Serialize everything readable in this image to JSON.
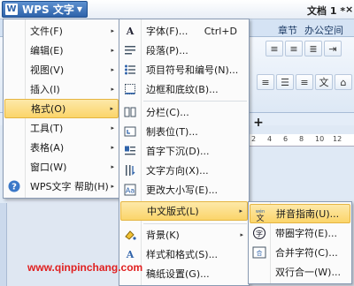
{
  "app": {
    "name": "WPS 文字",
    "logo": "W",
    "doc_title": "文档 1 *",
    "close": "×"
  },
  "ribbon": {
    "tabs": [
      "章节",
      "办公空间"
    ],
    "plus": "+",
    "ruler": [
      "2",
      "4",
      "6",
      "8",
      "10",
      "12"
    ]
  },
  "main_menu": {
    "items": [
      {
        "label": "文件(F)",
        "icon": "",
        "arrow": "▸"
      },
      {
        "label": "编辑(E)",
        "icon": "",
        "arrow": "▸"
      },
      {
        "label": "视图(V)",
        "icon": "",
        "arrow": "▸"
      },
      {
        "label": "插入(I)",
        "icon": "",
        "arrow": "▸"
      },
      {
        "label": "格式(O)",
        "icon": "",
        "arrow": "▸",
        "highlighted": true
      },
      {
        "label": "工具(T)",
        "icon": "",
        "arrow": "▸"
      },
      {
        "label": "表格(A)",
        "icon": "",
        "arrow": "▸"
      },
      {
        "label": "窗口(W)",
        "icon": "",
        "arrow": "▸"
      },
      {
        "label": "WPS文字 帮助(H)",
        "icon": "help-icon",
        "arrow": "▸"
      }
    ]
  },
  "format_menu": {
    "items": [
      {
        "label": "字体(F)...",
        "shortcut": "Ctrl+D",
        "icon": "font-icon"
      },
      {
        "label": "段落(P)...",
        "icon": "paragraph-icon"
      },
      {
        "label": "项目符号和编号(N)...",
        "icon": "bullets-icon"
      },
      {
        "label": "边框和底纹(B)...",
        "icon": "borders-icon"
      },
      {
        "label": "分栏(C)...",
        "icon": "columns-icon"
      },
      {
        "label": "制表位(T)...",
        "icon": "tabstop-icon"
      },
      {
        "label": "首字下沉(D)...",
        "icon": "dropcap-icon"
      },
      {
        "label": "文字方向(X)...",
        "icon": "text-direction-icon"
      },
      {
        "label": "更改大小写(E)...",
        "icon": "change-case-icon"
      },
      {
        "label": "中文版式(L)",
        "icon": "",
        "arrow": "▸",
        "highlighted": true
      },
      {
        "label": "背景(K)",
        "icon": "background-icon",
        "arrow": "▸"
      },
      {
        "label": "样式和格式(S)...",
        "icon": "styles-icon"
      },
      {
        "label": "稿纸设置(G)...",
        "icon": "manuscript-icon"
      }
    ]
  },
  "chinese_layout_menu": {
    "items": [
      {
        "label": "拼音指南(U)...",
        "icon": "pinyin-icon",
        "highlighted": true
      },
      {
        "label": "带圈字符(E)...",
        "icon": "enclosed-char-icon"
      },
      {
        "label": "合并字符(C)...",
        "icon": "combine-chars-icon"
      },
      {
        "label": "双行合一(W)...",
        "icon": ""
      }
    ]
  },
  "watermark": "www.qinpinchang.com"
}
